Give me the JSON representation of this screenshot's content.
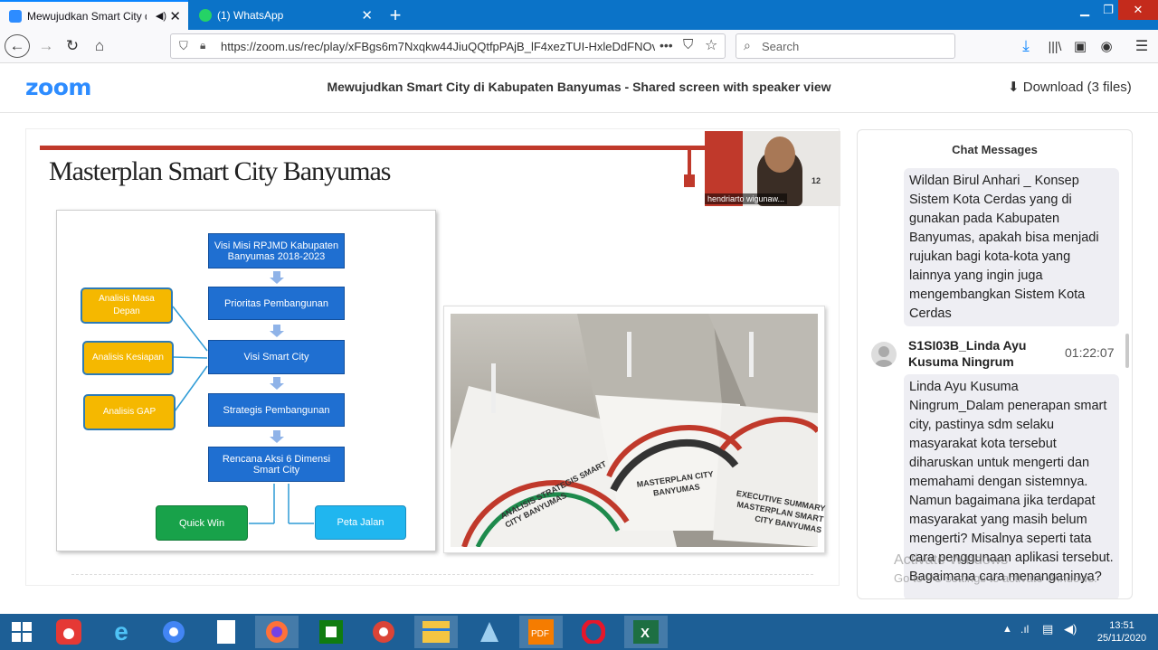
{
  "browser": {
    "tabs": [
      {
        "label": "Mewujudkan Smart City di I",
        "active": true
      },
      {
        "label": "(1) WhatsApp",
        "active": false
      }
    ],
    "url": "https://zoom.us/rec/play/xFBgs6m7Nxqkw44JiuQQtfpPAjB_lF4xezTUI-HxleDdFNOv",
    "search_placeholder": "Search"
  },
  "zoom": {
    "logo": "zoom",
    "title": "Mewujudkan Smart City di Kabupaten Banyumas - Shared screen with speaker view",
    "download_label": "Download (3 files)"
  },
  "slide": {
    "title": "Masterplan Smart City Banyumas",
    "flow_main": [
      "Visi Misi RPJMD Kabupaten Banyumas 2018-2023",
      "Prioritas Pembangunan",
      "Visi Smart City",
      "Strategis Pembangunan",
      "Rencana Aksi 6 Dimensi Smart City"
    ],
    "inputs": [
      "Analisis Masa Depan",
      "Analisis Kesiapan",
      "Analisis GAP"
    ],
    "outputs": [
      "Quick Win",
      "Peta Jalan"
    ],
    "books": [
      "ANALISIS STRATEGIS SMART CITY BANYUMAS",
      "MASTERPLAN CITY BANYUMAS",
      "EXECUTIVE SUMMARY MASTERPLAN SMART CITY BANYUMAS"
    ],
    "speaker_name": "hendriarto wigunaw..."
  },
  "chat": {
    "title": "Chat Messages",
    "message1": "Wildan Birul Anhari _ Konsep Sistem Kota Cerdas yang di gunakan pada Kabupaten Banyumas, apakah bisa menjadi rujukan bagi kota-kota yang lainnya yang ingin juga mengembangkan Sistem Kota Cerdas",
    "sender2": "S1SI03B_Linda Ayu Kusuma Ningrum",
    "time2": "01:22:07",
    "message2": "Linda Ayu Kusuma Ningrum_Dalam penerapan smart city, pastinya sdm selaku masyarakat kota tersebut diharuskan untuk mengerti dan memahami dengan sistemnya. Namun bagaimana jika terdapat masyarakat yang masih belum mengerti? Misalnya seperti tata cara penggunaan aplikasi tersebut. Bagaimana cara menanganinya?"
  },
  "watermark": {
    "line1": "Activate Windows",
    "line2": "Go to PC settings to activate Windows."
  },
  "taskbar": {
    "time": "13:51",
    "date": "25/11/2020"
  }
}
